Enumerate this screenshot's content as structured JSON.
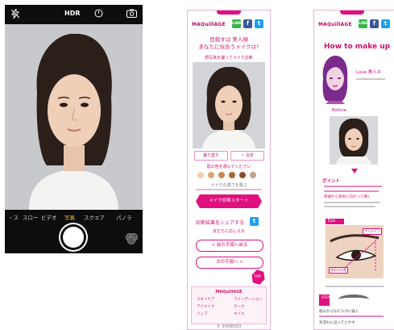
{
  "camera": {
    "flash_icon": "flash-off-icon",
    "hdr_label": "HDR",
    "timer_icon": "timer-icon",
    "switch_icon": "camera-switch-icon",
    "modes": [
      "スロー",
      "ビデオ",
      "写真",
      "スクエア",
      "パノラ"
    ],
    "active_mode": "写真",
    "filters_icon": "filters-icon"
  },
  "page1": {
    "brand": "MAQuillAGE",
    "social": {
      "line": "LINE",
      "facebook": "f",
      "twitter": "t"
    },
    "headline_line1": "目指すは 美人顔",
    "headline_line2": "あなたに似合うメイクは?",
    "subline": "顔写真を撮ってメイク診断",
    "photo_buttons": [
      "撮り直す",
      "✓ 決定"
    ],
    "color_prompt": "肌の色を選んでください",
    "skin_swatches": [
      "#f0cfa8",
      "#d9a870",
      "#c9894a",
      "#a9683a",
      "#8b4f2c",
      "#c4a38b"
    ],
    "slider_hint": "メイクの濃さを選ぶ",
    "cta_label": "メイク診断スタート",
    "share_text": "診断結果をシェアする",
    "share_sub": "友だちにおしえる",
    "nav_prev": "< 前の手順へ戻る",
    "nav_next": "次の手順へ >",
    "top_label": "TOP",
    "footer_title": "MAQuillAGE",
    "footer_items": [
      "スキンケア",
      "ファンデーション",
      "アイメイク",
      "チーク",
      "リップ",
      "ネイル"
    ],
    "copyright": "© SHISEIDO"
  },
  "page2": {
    "brand": "MAQuillAGE",
    "social": {
      "line": "LINE",
      "facebook": "f",
      "twitter": "t"
    },
    "howto_title": "How to make up",
    "illus_caption": "Love 美人ネ",
    "section1": "Before",
    "section2": "Eye",
    "notes_title": "ポイント",
    "notes": "目頭から目尻に向かって細く",
    "eye_tag": "アイライン",
    "eye_tag2": "眉尻の位置",
    "step_label": "STEP",
    "step_text1": "眉山からなだらかに描く",
    "step_text2": "毛流れに沿ってとかす"
  }
}
